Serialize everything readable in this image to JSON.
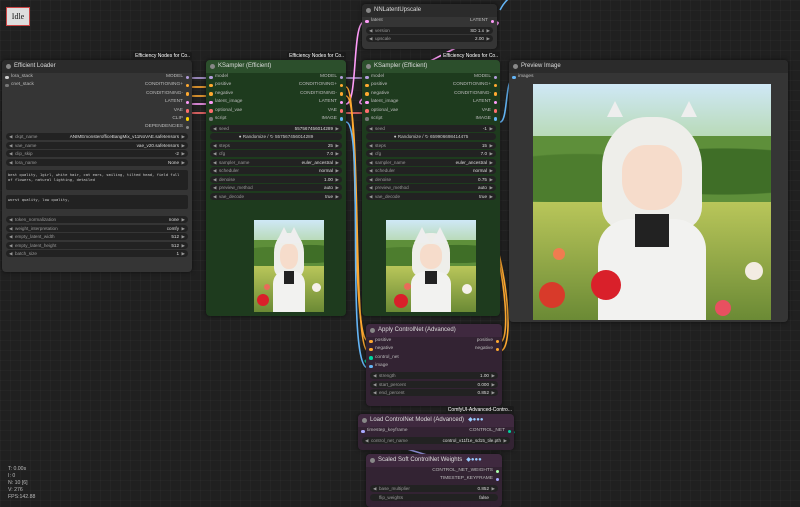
{
  "status": {
    "idle_label": "Idle"
  },
  "stats": [
    "T: 0.00s",
    "I: 0",
    "N: 10 [6]",
    "V: 276",
    "FPS:142.88"
  ],
  "badges": {
    "efficiency_1": "Efficiency Nodes for Co..",
    "efficiency_2": "Efficiency Nodes for Co..",
    "efficiency_3": "Efficiency Nodes for Co..",
    "comfyui_adv": "ComfyUI-Advanced-Contro..."
  },
  "loader": {
    "title": "Efficient Loader",
    "inputs": [
      "lora_stack",
      "cnet_stack"
    ],
    "outputs": [
      "MODEL",
      "CONDITIONING+",
      "CONDITIONING-",
      "LATENT",
      "VAE",
      "CLIP",
      "DEPENDENCIES"
    ],
    "widgets": [
      {
        "label": "ckpt_name",
        "value": "ANIMEmonsterofficeBangMix_v11NoVAE.safetensors"
      },
      {
        "label": "vae_name",
        "value": "vae_v20.safetensors"
      },
      {
        "label": "clip_skip",
        "value": "-2"
      },
      {
        "label": "lora_name",
        "value": "None"
      }
    ],
    "positive_prompt": "best quality, 1girl, white hair, cat ears, smiling, tilted head, field full of flowers, natural lighting, detailed",
    "negative_prompt": "worst quality, low quality,",
    "widgets2": [
      {
        "label": "token_normalization",
        "value": "none"
      },
      {
        "label": "weight_interpretation",
        "value": "comfy"
      },
      {
        "label": "empty_latent_width",
        "value": "512"
      },
      {
        "label": "empty_latent_height",
        "value": "512"
      },
      {
        "label": "batch_size",
        "value": "1"
      }
    ]
  },
  "ksampler1": {
    "title": "KSampler (Efficient)",
    "ports": [
      {
        "in": "model",
        "out": "MODEL"
      },
      {
        "in": "positive",
        "out": "CONDITIONING+"
      },
      {
        "in": "negative",
        "out": "CONDITIONING-"
      },
      {
        "in": "latent_image",
        "out": "LATENT"
      },
      {
        "in": "optional_vae",
        "out": "VAE"
      },
      {
        "in": "script",
        "out": "IMAGE"
      }
    ],
    "seed": "557567456014289",
    "randomize": "Randomize / ↻ 557567456014289",
    "widgets": [
      {
        "label": "steps",
        "value": "25"
      },
      {
        "label": "cfg",
        "value": "7.0"
      },
      {
        "label": "sampler_name",
        "value": "euler_ancestral"
      },
      {
        "label": "scheduler",
        "value": "normal"
      },
      {
        "label": "denoise",
        "value": "1.00"
      },
      {
        "label": "preview_method",
        "value": "auto"
      },
      {
        "label": "vae_decode",
        "value": "true"
      }
    ]
  },
  "ksampler2": {
    "title": "KSampler (Efficient)",
    "ports": [
      {
        "in": "model",
        "out": "MODEL"
      },
      {
        "in": "positive",
        "out": "CONDITIONING+"
      },
      {
        "in": "negative",
        "out": "CONDITIONING-"
      },
      {
        "in": "latent_image",
        "out": "LATENT"
      },
      {
        "in": "optional_vae",
        "out": "VAE"
      },
      {
        "in": "script",
        "out": "IMAGE"
      }
    ],
    "seed": "-1",
    "randomize": "Randomize / ↻ 659906698414475",
    "widgets": [
      {
        "label": "steps",
        "value": "15"
      },
      {
        "label": "cfg",
        "value": "7.0"
      },
      {
        "label": "sampler_name",
        "value": "euler_ancestral"
      },
      {
        "label": "scheduler",
        "value": "normal"
      },
      {
        "label": "denoise",
        "value": "0.75"
      },
      {
        "label": "preview_method",
        "value": "auto"
      },
      {
        "label": "vae_decode",
        "value": "true"
      }
    ]
  },
  "nnupscale": {
    "title": "NNLatentUpscale",
    "port_in": "latent",
    "port_out": "LATENT",
    "widgets": [
      {
        "label": "version",
        "value": "SD 1.x"
      },
      {
        "label": "upscale",
        "value": "2.00"
      }
    ]
  },
  "preview": {
    "title": "Preview Image",
    "input": "images"
  },
  "applycn": {
    "title": "Apply ControlNet (Advanced)",
    "ports": [
      {
        "in": "positive",
        "out": "positive"
      },
      {
        "in": "negative",
        "out": "negative"
      },
      {
        "in": "control_net",
        "out": ""
      },
      {
        "in": "image",
        "out": ""
      }
    ],
    "widgets": [
      {
        "label": "strength",
        "value": "1.00"
      },
      {
        "label": "start_percent",
        "value": "0.000"
      },
      {
        "label": "end_percent",
        "value": "0.852"
      }
    ]
  },
  "loadcn": {
    "title": "Load ControlNet Model (Advanced)",
    "port_in": "timestep_keyframe",
    "port_out": "CONTROL_NET",
    "widget": {
      "label": "control_net_name",
      "value": "control_v11f1e_sd15_tile.pth"
    }
  },
  "scaledsoft": {
    "title": "Scaled Soft ControlNet Weights",
    "outputs": [
      "CONTROL_NET_WEIGHTS",
      "TIMESTEP_KEYFRAME"
    ],
    "widgets": [
      {
        "label": "base_multiplier",
        "value": "0.852"
      },
      {
        "label": "flip_weights",
        "value": "false"
      }
    ]
  },
  "colors": {
    "wire_model": "#b39ddb",
    "wire_cond_pos": "#ffa931",
    "wire_cond_neg": "#ffa931",
    "wire_latent": "#ff9cf9",
    "wire_vae": "#ff6e6e",
    "wire_image": "#64b5f6",
    "node_green": "#1e3b1e",
    "node_purple": "#332333",
    "node_gray": "#353535"
  }
}
